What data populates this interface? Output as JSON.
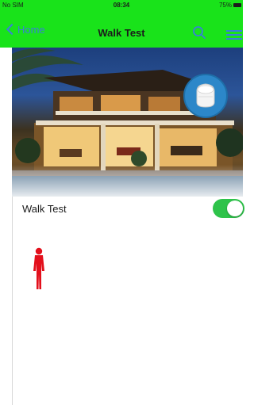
{
  "status_bar": {
    "carrier": "No SIM",
    "time": "08:34",
    "battery": "75%"
  },
  "nav": {
    "back_label": "Home",
    "title": "Walk Test"
  },
  "walk_test": {
    "label": "Walk Test",
    "enabled": true
  },
  "colors": {
    "bar_green": "#19e31a",
    "link_blue": "#3a7fd9",
    "toggle_green": "#2ec34a",
    "person_red": "#e3101c"
  }
}
